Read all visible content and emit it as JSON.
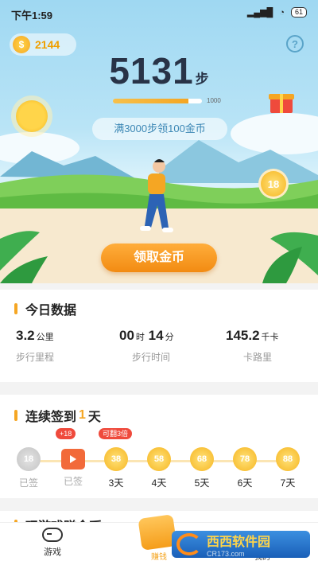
{
  "status_bar": {
    "time": "下午1:59",
    "battery": "61"
  },
  "header": {
    "coins": "2144",
    "help_symbol": "?"
  },
  "steps": {
    "count": "5131",
    "unit": "步",
    "progress_fraction": 0.85,
    "progress_max_label": "1000"
  },
  "goal_text": "满3000步领100金币",
  "bubble_coin": "18",
  "claim_button": "领取金币",
  "today": {
    "title": "今日数据",
    "stats": [
      {
        "value": "3.2",
        "unit": "公里",
        "label": "步行里程"
      },
      {
        "value": "00",
        "unit": "时",
        "value2": "14",
        "unit2": "分",
        "label": "步行时间"
      },
      {
        "value": "145.2",
        "unit": "千卡",
        "label": "卡路里"
      }
    ]
  },
  "signin": {
    "title_prefix": "连续签到",
    "title_days": "1",
    "title_suffix": "天",
    "days": [
      {
        "coin": "18",
        "label": "已签",
        "state": "done"
      },
      {
        "coin": "",
        "label": "已签",
        "state": "video",
        "badge": "+18"
      },
      {
        "coin": "38",
        "label": "3天",
        "state": "todo",
        "badge": "可翻3倍"
      },
      {
        "coin": "58",
        "label": "4天",
        "state": "todo"
      },
      {
        "coin": "68",
        "label": "5天",
        "state": "todo"
      },
      {
        "coin": "78",
        "label": "6天",
        "state": "todo"
      },
      {
        "coin": "88",
        "label": "7天",
        "state": "todo"
      }
    ]
  },
  "next_section_title": "玩游戏赚金币",
  "tabs": [
    {
      "label": "游戏"
    },
    {
      "label": "赚钱"
    },
    {
      "label": "我的"
    }
  ],
  "watermark": {
    "title": "西西软件园",
    "url": "CR173.com"
  },
  "colors": {
    "accent": "#f5a623",
    "sky": "#9fd8f2",
    "claim": "#f28b12"
  }
}
